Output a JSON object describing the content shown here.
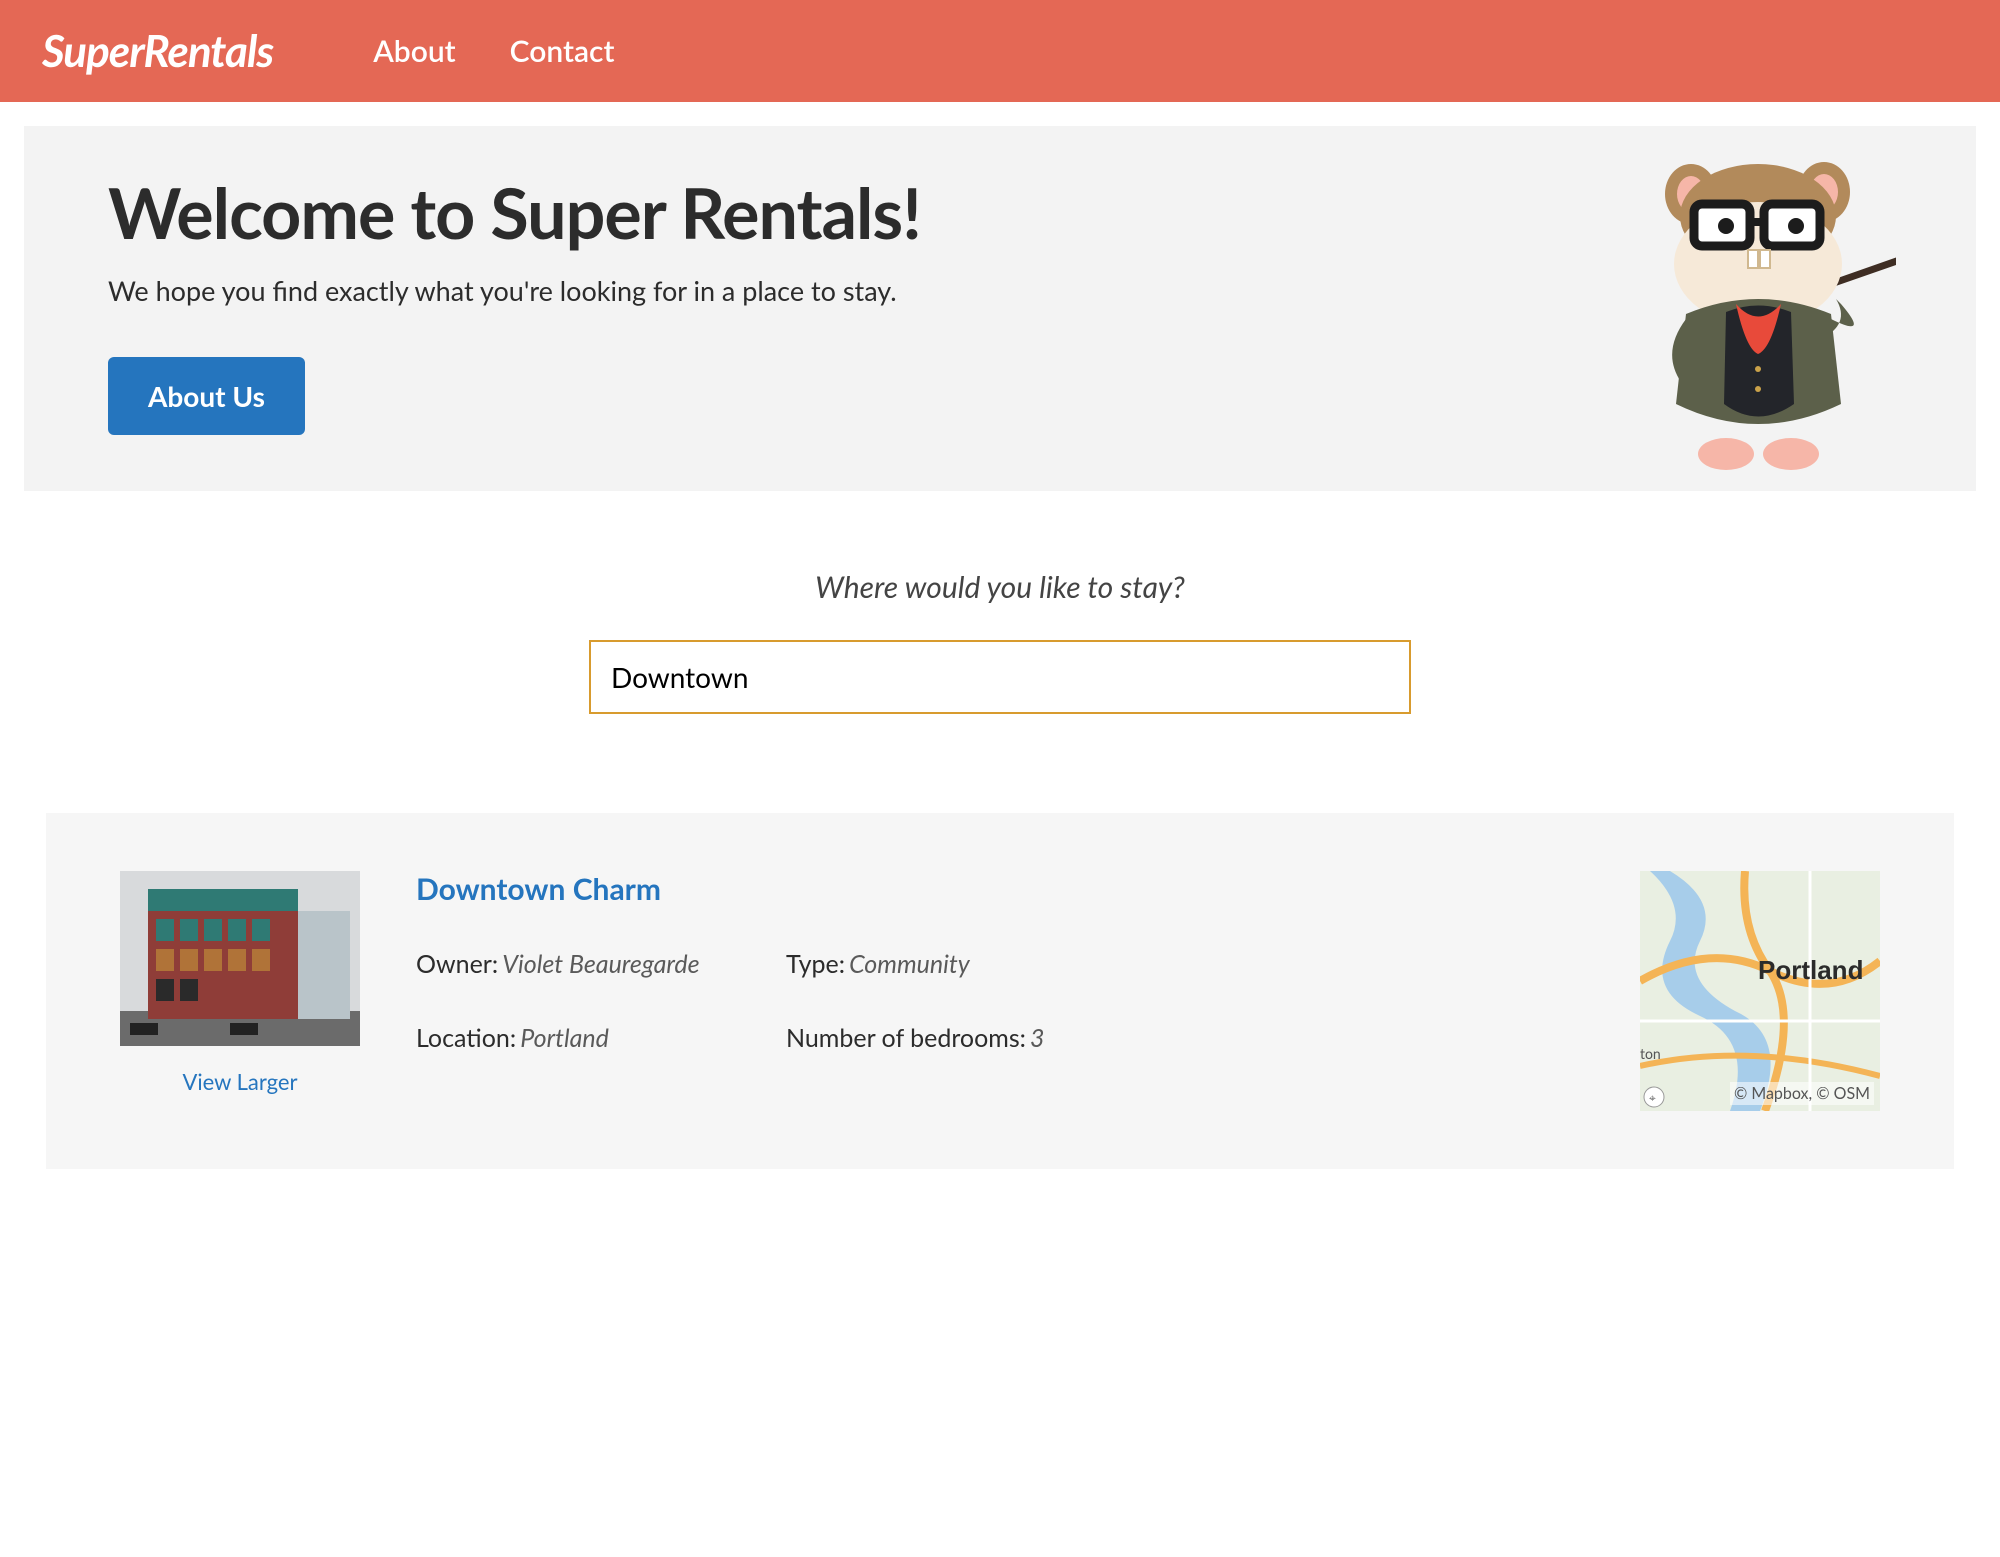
{
  "nav": {
    "brand": "SuperRentals",
    "links": [
      "About",
      "Contact"
    ]
  },
  "hero": {
    "title": "Welcome to Super Rentals!",
    "subtitle": "We hope you find exactly what you're looking for in a place to stay.",
    "cta": "About Us"
  },
  "search": {
    "prompt": "Where would you like to stay?",
    "value": "Downtown"
  },
  "listing": {
    "title": "Downtown Charm",
    "view_larger": "View Larger",
    "labels": {
      "owner": "Owner:",
      "type": "Type:",
      "location": "Location:",
      "bedrooms": "Number of bedrooms:"
    },
    "values": {
      "owner": "Violet Beauregarde",
      "type": "Community",
      "location": "Portland",
      "bedrooms": "3"
    },
    "map_label": "Portland",
    "map_attribution": "© Mapbox, © OSM"
  }
}
